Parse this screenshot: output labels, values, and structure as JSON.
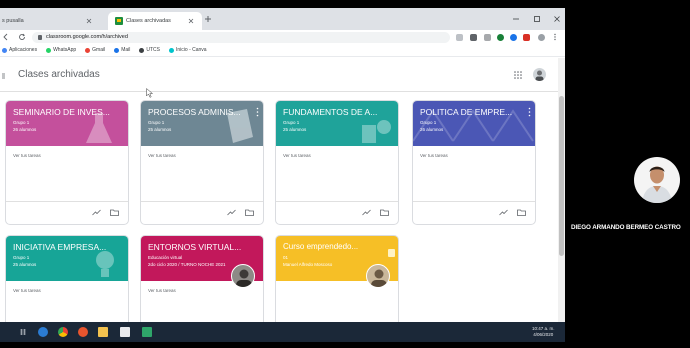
{
  "browser": {
    "tabs": [
      {
        "label": "s pusalla"
      },
      {
        "label": "Clases archivadas"
      }
    ],
    "url": "classroom.google.com/h/archived",
    "bookmarks": [
      {
        "label": "Aplicaciones",
        "color": "#4285f4"
      },
      {
        "label": "WhatsApp",
        "color": "#25d366"
      },
      {
        "label": "Gmail",
        "color": "#ea4335"
      },
      {
        "label": "Mail",
        "color": "#1a73e8"
      },
      {
        "label": "UTCS",
        "color": "#3c4043"
      },
      {
        "label": "Inicio - Canva",
        "color": "#00c4cc"
      }
    ]
  },
  "classroom": {
    "page_title": "Clases archivadas"
  },
  "cards": [
    {
      "title": "SEMINARIO DE INVES...",
      "section": "Grupo 1",
      "students": "26 alumnos",
      "body": "Ver tus tareas",
      "color": "#c4509c"
    },
    {
      "title": "PROCESOS ADMINIS...",
      "section": "Grupo 1",
      "students": "25 alumnos",
      "body": "Ver tus tareas",
      "color": "#6e8794"
    },
    {
      "title": "FUNDAMENTOS DE A...",
      "section": "Grupo 1",
      "students": "25 alumnos",
      "body": "Ver tus tareas",
      "color": "#1fa39a"
    },
    {
      "title": "POLITICA DE EMPRE...",
      "section": "Grupo 1",
      "students": "26 alumnos",
      "body": "Ver tus tareas",
      "color": "#4b57b5"
    },
    {
      "title": "INICIATIVA EMPRESA...",
      "section": "Grupo 1",
      "students": "25 alumnos",
      "body": "Ver tus tareas",
      "color": "#17a597"
    },
    {
      "title": "ENTORNOS VIRTUAL...",
      "section": "Educación virtual",
      "students": "2do ciclo 2020 / TURNO NOCHE 2021",
      "body": "Ver tus tareas",
      "color": "#c2185b"
    },
    {
      "title": "Curso emprendedo...",
      "section": "01",
      "students": "Manuel Alfredo Moscoso",
      "body": "",
      "color": "#f6bf26"
    }
  ],
  "taskbar": {
    "time": "10:47 a. m.",
    "date": "4/06/2020"
  },
  "participant": {
    "name": "DIEGO ARMANDO BERMEO CASTRO"
  }
}
